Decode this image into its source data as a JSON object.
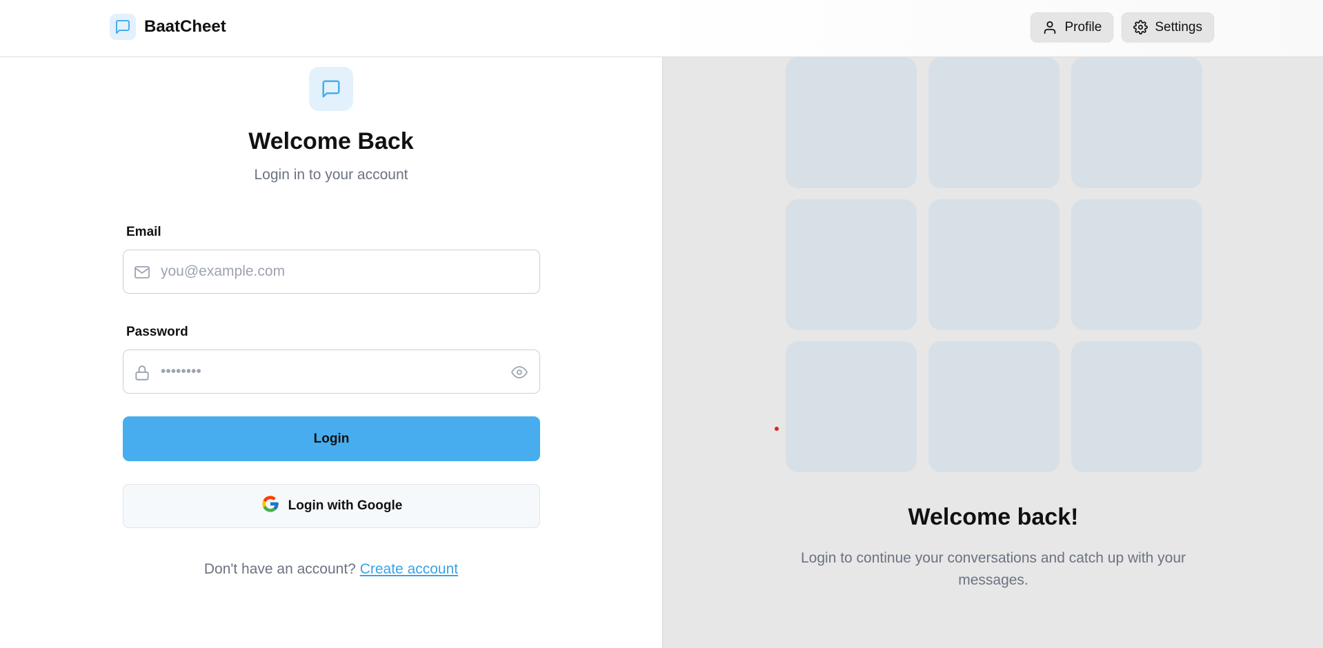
{
  "header": {
    "brand_name": "BaatCheet",
    "brand_icon": "message-square-icon",
    "profile_label": "Profile",
    "settings_label": "Settings"
  },
  "login": {
    "title": "Welcome Back",
    "subtitle": "Login in to your account",
    "email_label": "Email",
    "email_placeholder": "you@example.com",
    "email_value": "",
    "password_label": "Password",
    "password_placeholder": "••••••••",
    "password_value": "",
    "login_button": "Login",
    "google_button": "Login with Google",
    "signup_prompt": "Don't have an account?",
    "signup_link": "Create account"
  },
  "side_panel": {
    "title": "Welcome back!",
    "text": "Login to continue your conversations and catch up with your messages."
  },
  "colors": {
    "accent": "#47adee",
    "link": "#3aa3e4",
    "icon_bg": "#e2f1fb",
    "tile": "#d8e0e7",
    "panel_bg": "#e7e7e7"
  }
}
